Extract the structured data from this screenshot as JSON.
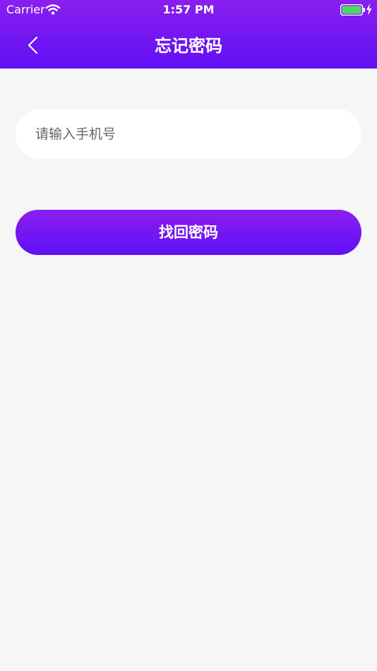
{
  "status_bar": {
    "carrier": "Carrier",
    "time": "1:57 PM",
    "wifi_icon": "wifi-icon",
    "battery_icon": "battery-icon",
    "charging_icon": "charging-bolt-icon",
    "battery_level": 1.0
  },
  "navigation": {
    "back_icon": "chevron-left-icon",
    "title": "忘记密码"
  },
  "form": {
    "phone_placeholder": "请输入手机号",
    "phone_value": "",
    "submit_label": "找回密码"
  },
  "colors": {
    "accent_top": "#8a1fef",
    "accent_bottom": "#5f10f5",
    "background": "#f6f6f6",
    "field_background": "#ffffff",
    "battery_fill": "#4cd964",
    "text_white": "#ffffff",
    "placeholder_text": "#666666"
  }
}
